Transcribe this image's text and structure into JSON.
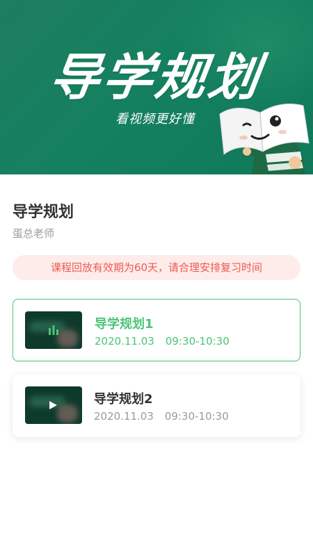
{
  "banner": {
    "title": "导学规划",
    "subtitle": "看视频更好懂"
  },
  "course": {
    "title": "导学规划",
    "teacher": "蛋总老师"
  },
  "notice": "课程回放有效期为60天，请合理安排复习时间",
  "lessons": [
    {
      "name": "导学规划1",
      "date": "2020.11.03",
      "time": "09:30-10:30",
      "state": "playing",
      "icon": "equalizer-icon"
    },
    {
      "name": "导学规划2",
      "date": "2020.11.03",
      "time": "09:30-10:30",
      "state": "idle",
      "icon": "play-icon"
    }
  ],
  "colors": {
    "banner_green": "#15805f",
    "accent_green": "#4cc477",
    "notice_bg": "#fdecea",
    "notice_text": "#ee5a52"
  }
}
